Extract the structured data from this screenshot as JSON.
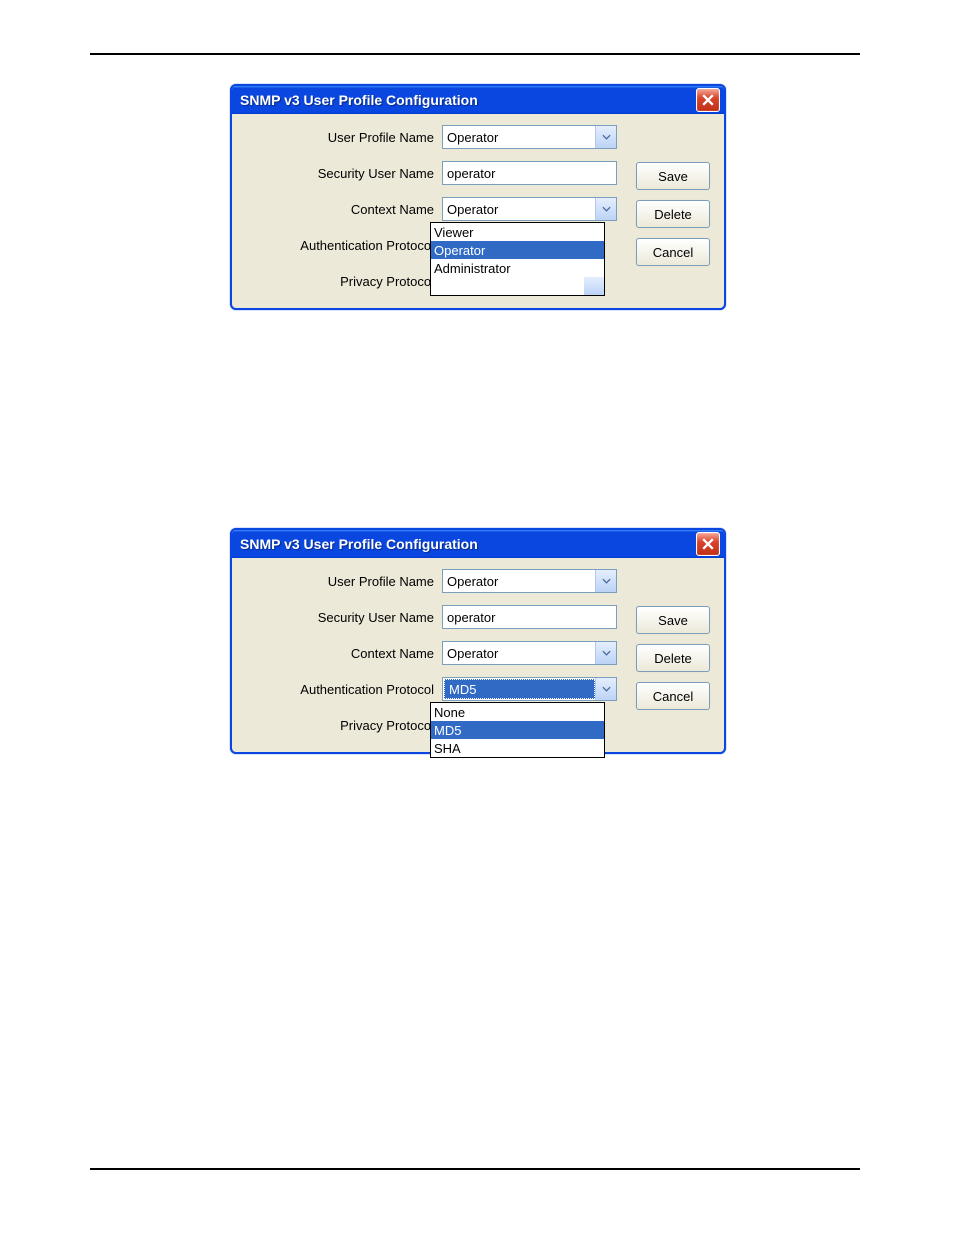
{
  "dialog1": {
    "title": "SNMP v3 User Profile Configuration",
    "labels": {
      "profile": "User Profile Name",
      "security": "Security User Name",
      "context": "Context Name",
      "auth": "Authentication Protocol",
      "privacy": "Privacy Protocol"
    },
    "values": {
      "profile": "Operator",
      "security": "operator",
      "context": "Operator"
    },
    "dropdown": {
      "opt1": "Viewer",
      "opt2": "Operator",
      "opt3": "Administrator"
    },
    "buttons": {
      "save": "Save",
      "delete": "Delete",
      "cancel": "Cancel"
    }
  },
  "dialog2": {
    "title": "SNMP v3 User Profile Configuration",
    "labels": {
      "profile": "User Profile Name",
      "security": "Security User Name",
      "context": "Context Name",
      "auth": "Authentication Protocol",
      "privacy": "Privacy Protocol"
    },
    "values": {
      "profile": "Operator",
      "security": "operator",
      "context": "Operator",
      "auth": "MD5"
    },
    "dropdown": {
      "opt1": "None",
      "opt2": "MD5",
      "opt3": "SHA"
    },
    "buttons": {
      "save": "Save",
      "delete": "Delete",
      "cancel": "Cancel"
    }
  }
}
